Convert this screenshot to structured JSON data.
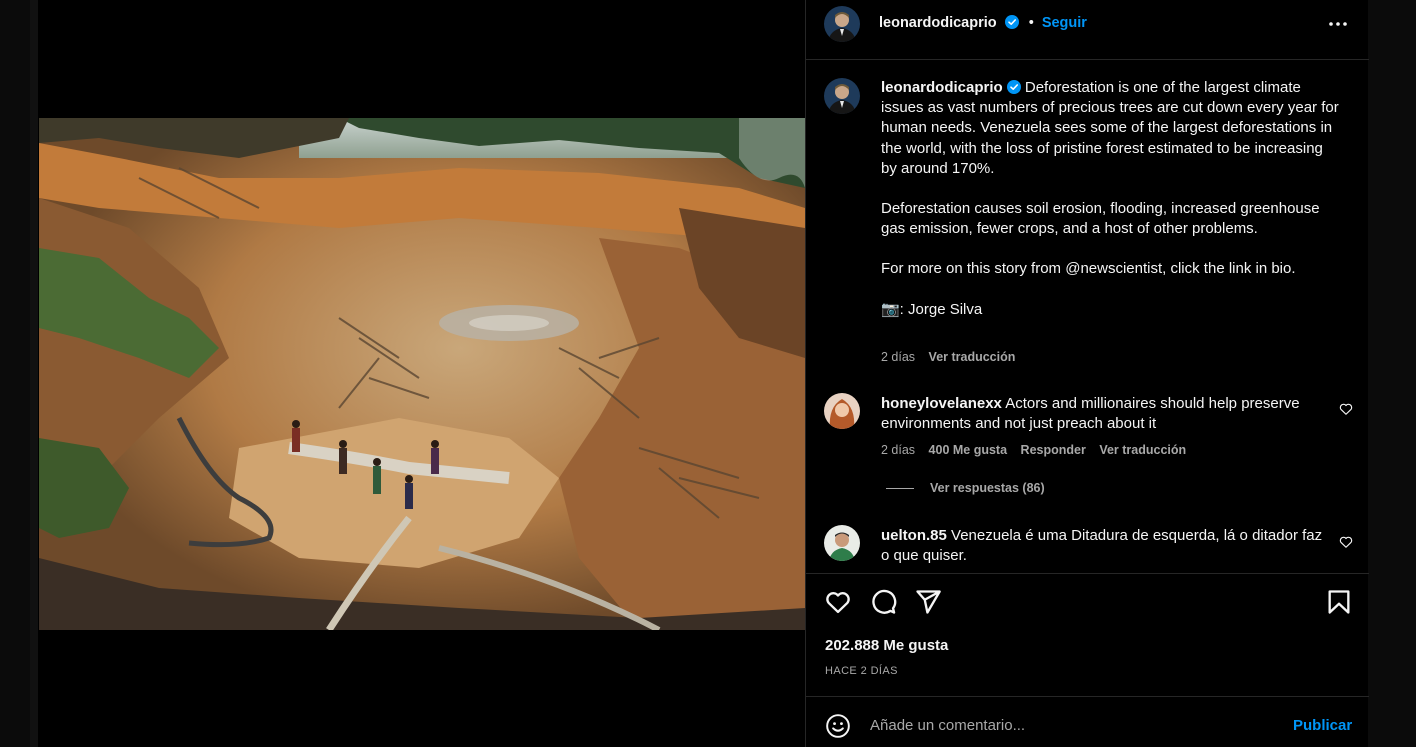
{
  "post": {
    "username": "leonardodicaprio",
    "follow_label": "Seguir",
    "separator": "•",
    "caption": {
      "paragraph1": "Deforestation is one of the largest climate issues as vast numbers of precious trees are cut down every year for human needs. Venezuela sees some of the largest deforestations in the world, with the loss of pristine forest estimated to be increasing by around 170%.",
      "paragraph2": "Deforestation causes soil erosion, flooding, increased greenhouse gas emission, fewer crops, and a host of other problems.",
      "paragraph3": "For more on this story from @newscientist, click the link in bio.",
      "credit": "📷: Jorge Silva"
    },
    "caption_time": "2 días",
    "caption_translate": "Ver traducción",
    "likes": "202.888 Me gusta",
    "posted_ago": "HACE 2 DÍAS"
  },
  "comments": [
    {
      "username": "honeylovelanexx",
      "text": "Actors and millionaires should help preserve environments and not just preach about it",
      "time": "2 días",
      "likes": "400 Me gusta",
      "reply": "Responder",
      "translate": "Ver traducción",
      "view_replies": "Ver respuestas (86)"
    },
    {
      "username": "uelton.85",
      "text": "Venezuela é uma Ditadura de esquerda, lá o ditador faz o que quiser."
    }
  ],
  "composer": {
    "placeholder": "Añade un comentario...",
    "publish": "Publicar"
  },
  "icons": {
    "verified": "verified-badge-icon",
    "more": "more-options-icon",
    "like": "heart-icon",
    "comment": "comment-icon",
    "share": "share-icon",
    "save": "bookmark-icon",
    "emoji": "emoji-icon"
  },
  "colors": {
    "background": "#000000",
    "link_blue": "#0095f6",
    "muted_text": "#a8a8a8",
    "divider": "#262626"
  }
}
